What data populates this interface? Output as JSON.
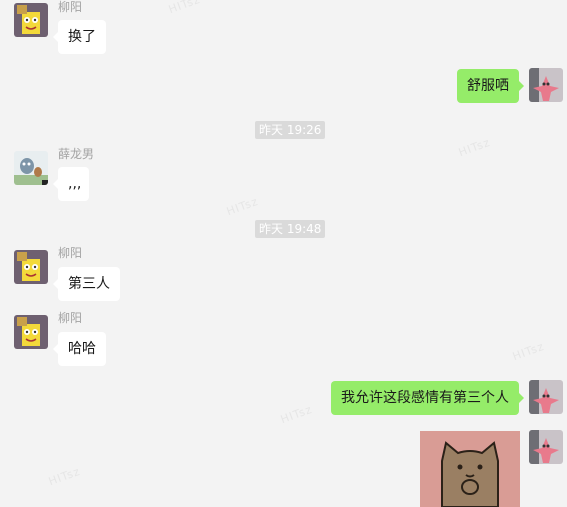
{
  "watermark": "HITsz",
  "messages": [
    {
      "sender": "柳阳",
      "text": "换了"
    },
    {
      "text": "舒服哂"
    },
    {
      "time": "昨天 19:26"
    },
    {
      "sender": "薛龙男",
      "text": ",,,"
    },
    {
      "time": "昨天 19:48"
    },
    {
      "sender": "柳阳",
      "text": "第三人"
    },
    {
      "sender": "柳阳",
      "text": "哈哈"
    },
    {
      "text": "我允许这段感情有第三个人"
    }
  ],
  "icons": {
    "avatar_liuyang": "sponge-avatar-icon",
    "avatar_xue": "cat-mouse-avatar-icon",
    "avatar_self": "starfish-avatar-icon",
    "sticker": "cat-sticker-icon"
  },
  "colors": {
    "background": "#f3f3f3",
    "incoming_bubble": "#ffffff",
    "outgoing_bubble": "#95ec69",
    "time_badge": "#dadada"
  }
}
